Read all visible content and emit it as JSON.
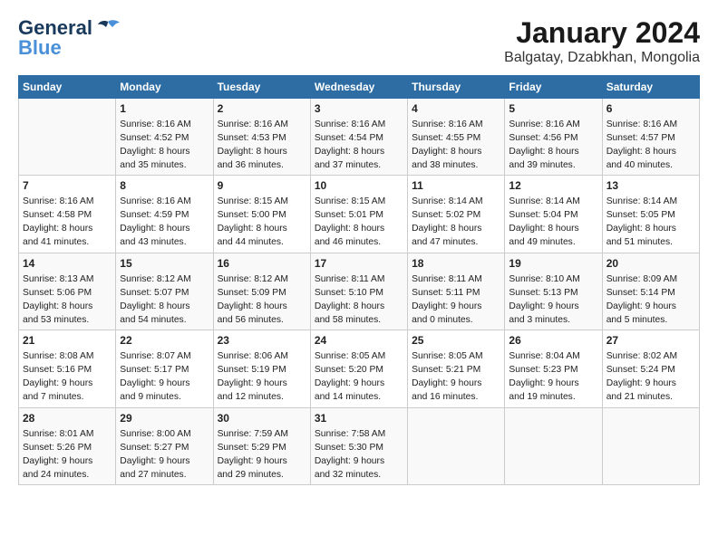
{
  "header": {
    "logo_line1": "General",
    "logo_line2": "Blue",
    "title": "January 2024",
    "subtitle": "Balgatay, Dzabkhan, Mongolia"
  },
  "days_of_week": [
    "Sunday",
    "Monday",
    "Tuesday",
    "Wednesday",
    "Thursday",
    "Friday",
    "Saturday"
  ],
  "weeks": [
    [
      {
        "day": "",
        "lines": []
      },
      {
        "day": "1",
        "lines": [
          "Sunrise: 8:16 AM",
          "Sunset: 4:52 PM",
          "Daylight: 8 hours",
          "and 35 minutes."
        ]
      },
      {
        "day": "2",
        "lines": [
          "Sunrise: 8:16 AM",
          "Sunset: 4:53 PM",
          "Daylight: 8 hours",
          "and 36 minutes."
        ]
      },
      {
        "day": "3",
        "lines": [
          "Sunrise: 8:16 AM",
          "Sunset: 4:54 PM",
          "Daylight: 8 hours",
          "and 37 minutes."
        ]
      },
      {
        "day": "4",
        "lines": [
          "Sunrise: 8:16 AM",
          "Sunset: 4:55 PM",
          "Daylight: 8 hours",
          "and 38 minutes."
        ]
      },
      {
        "day": "5",
        "lines": [
          "Sunrise: 8:16 AM",
          "Sunset: 4:56 PM",
          "Daylight: 8 hours",
          "and 39 minutes."
        ]
      },
      {
        "day": "6",
        "lines": [
          "Sunrise: 8:16 AM",
          "Sunset: 4:57 PM",
          "Daylight: 8 hours",
          "and 40 minutes."
        ]
      }
    ],
    [
      {
        "day": "7",
        "lines": [
          "Sunrise: 8:16 AM",
          "Sunset: 4:58 PM",
          "Daylight: 8 hours",
          "and 41 minutes."
        ]
      },
      {
        "day": "8",
        "lines": [
          "Sunrise: 8:16 AM",
          "Sunset: 4:59 PM",
          "Daylight: 8 hours",
          "and 43 minutes."
        ]
      },
      {
        "day": "9",
        "lines": [
          "Sunrise: 8:15 AM",
          "Sunset: 5:00 PM",
          "Daylight: 8 hours",
          "and 44 minutes."
        ]
      },
      {
        "day": "10",
        "lines": [
          "Sunrise: 8:15 AM",
          "Sunset: 5:01 PM",
          "Daylight: 8 hours",
          "and 46 minutes."
        ]
      },
      {
        "day": "11",
        "lines": [
          "Sunrise: 8:14 AM",
          "Sunset: 5:02 PM",
          "Daylight: 8 hours",
          "and 47 minutes."
        ]
      },
      {
        "day": "12",
        "lines": [
          "Sunrise: 8:14 AM",
          "Sunset: 5:04 PM",
          "Daylight: 8 hours",
          "and 49 minutes."
        ]
      },
      {
        "day": "13",
        "lines": [
          "Sunrise: 8:14 AM",
          "Sunset: 5:05 PM",
          "Daylight: 8 hours",
          "and 51 minutes."
        ]
      }
    ],
    [
      {
        "day": "14",
        "lines": [
          "Sunrise: 8:13 AM",
          "Sunset: 5:06 PM",
          "Daylight: 8 hours",
          "and 53 minutes."
        ]
      },
      {
        "day": "15",
        "lines": [
          "Sunrise: 8:12 AM",
          "Sunset: 5:07 PM",
          "Daylight: 8 hours",
          "and 54 minutes."
        ]
      },
      {
        "day": "16",
        "lines": [
          "Sunrise: 8:12 AM",
          "Sunset: 5:09 PM",
          "Daylight: 8 hours",
          "and 56 minutes."
        ]
      },
      {
        "day": "17",
        "lines": [
          "Sunrise: 8:11 AM",
          "Sunset: 5:10 PM",
          "Daylight: 8 hours",
          "and 58 minutes."
        ]
      },
      {
        "day": "18",
        "lines": [
          "Sunrise: 8:11 AM",
          "Sunset: 5:11 PM",
          "Daylight: 9 hours",
          "and 0 minutes."
        ]
      },
      {
        "day": "19",
        "lines": [
          "Sunrise: 8:10 AM",
          "Sunset: 5:13 PM",
          "Daylight: 9 hours",
          "and 3 minutes."
        ]
      },
      {
        "day": "20",
        "lines": [
          "Sunrise: 8:09 AM",
          "Sunset: 5:14 PM",
          "Daylight: 9 hours",
          "and 5 minutes."
        ]
      }
    ],
    [
      {
        "day": "21",
        "lines": [
          "Sunrise: 8:08 AM",
          "Sunset: 5:16 PM",
          "Daylight: 9 hours",
          "and 7 minutes."
        ]
      },
      {
        "day": "22",
        "lines": [
          "Sunrise: 8:07 AM",
          "Sunset: 5:17 PM",
          "Daylight: 9 hours",
          "and 9 minutes."
        ]
      },
      {
        "day": "23",
        "lines": [
          "Sunrise: 8:06 AM",
          "Sunset: 5:19 PM",
          "Daylight: 9 hours",
          "and 12 minutes."
        ]
      },
      {
        "day": "24",
        "lines": [
          "Sunrise: 8:05 AM",
          "Sunset: 5:20 PM",
          "Daylight: 9 hours",
          "and 14 minutes."
        ]
      },
      {
        "day": "25",
        "lines": [
          "Sunrise: 8:05 AM",
          "Sunset: 5:21 PM",
          "Daylight: 9 hours",
          "and 16 minutes."
        ]
      },
      {
        "day": "26",
        "lines": [
          "Sunrise: 8:04 AM",
          "Sunset: 5:23 PM",
          "Daylight: 9 hours",
          "and 19 minutes."
        ]
      },
      {
        "day": "27",
        "lines": [
          "Sunrise: 8:02 AM",
          "Sunset: 5:24 PM",
          "Daylight: 9 hours",
          "and 21 minutes."
        ]
      }
    ],
    [
      {
        "day": "28",
        "lines": [
          "Sunrise: 8:01 AM",
          "Sunset: 5:26 PM",
          "Daylight: 9 hours",
          "and 24 minutes."
        ]
      },
      {
        "day": "29",
        "lines": [
          "Sunrise: 8:00 AM",
          "Sunset: 5:27 PM",
          "Daylight: 9 hours",
          "and 27 minutes."
        ]
      },
      {
        "day": "30",
        "lines": [
          "Sunrise: 7:59 AM",
          "Sunset: 5:29 PM",
          "Daylight: 9 hours",
          "and 29 minutes."
        ]
      },
      {
        "day": "31",
        "lines": [
          "Sunrise: 7:58 AM",
          "Sunset: 5:30 PM",
          "Daylight: 9 hours",
          "and 32 minutes."
        ]
      },
      {
        "day": "",
        "lines": []
      },
      {
        "day": "",
        "lines": []
      },
      {
        "day": "",
        "lines": []
      }
    ]
  ]
}
